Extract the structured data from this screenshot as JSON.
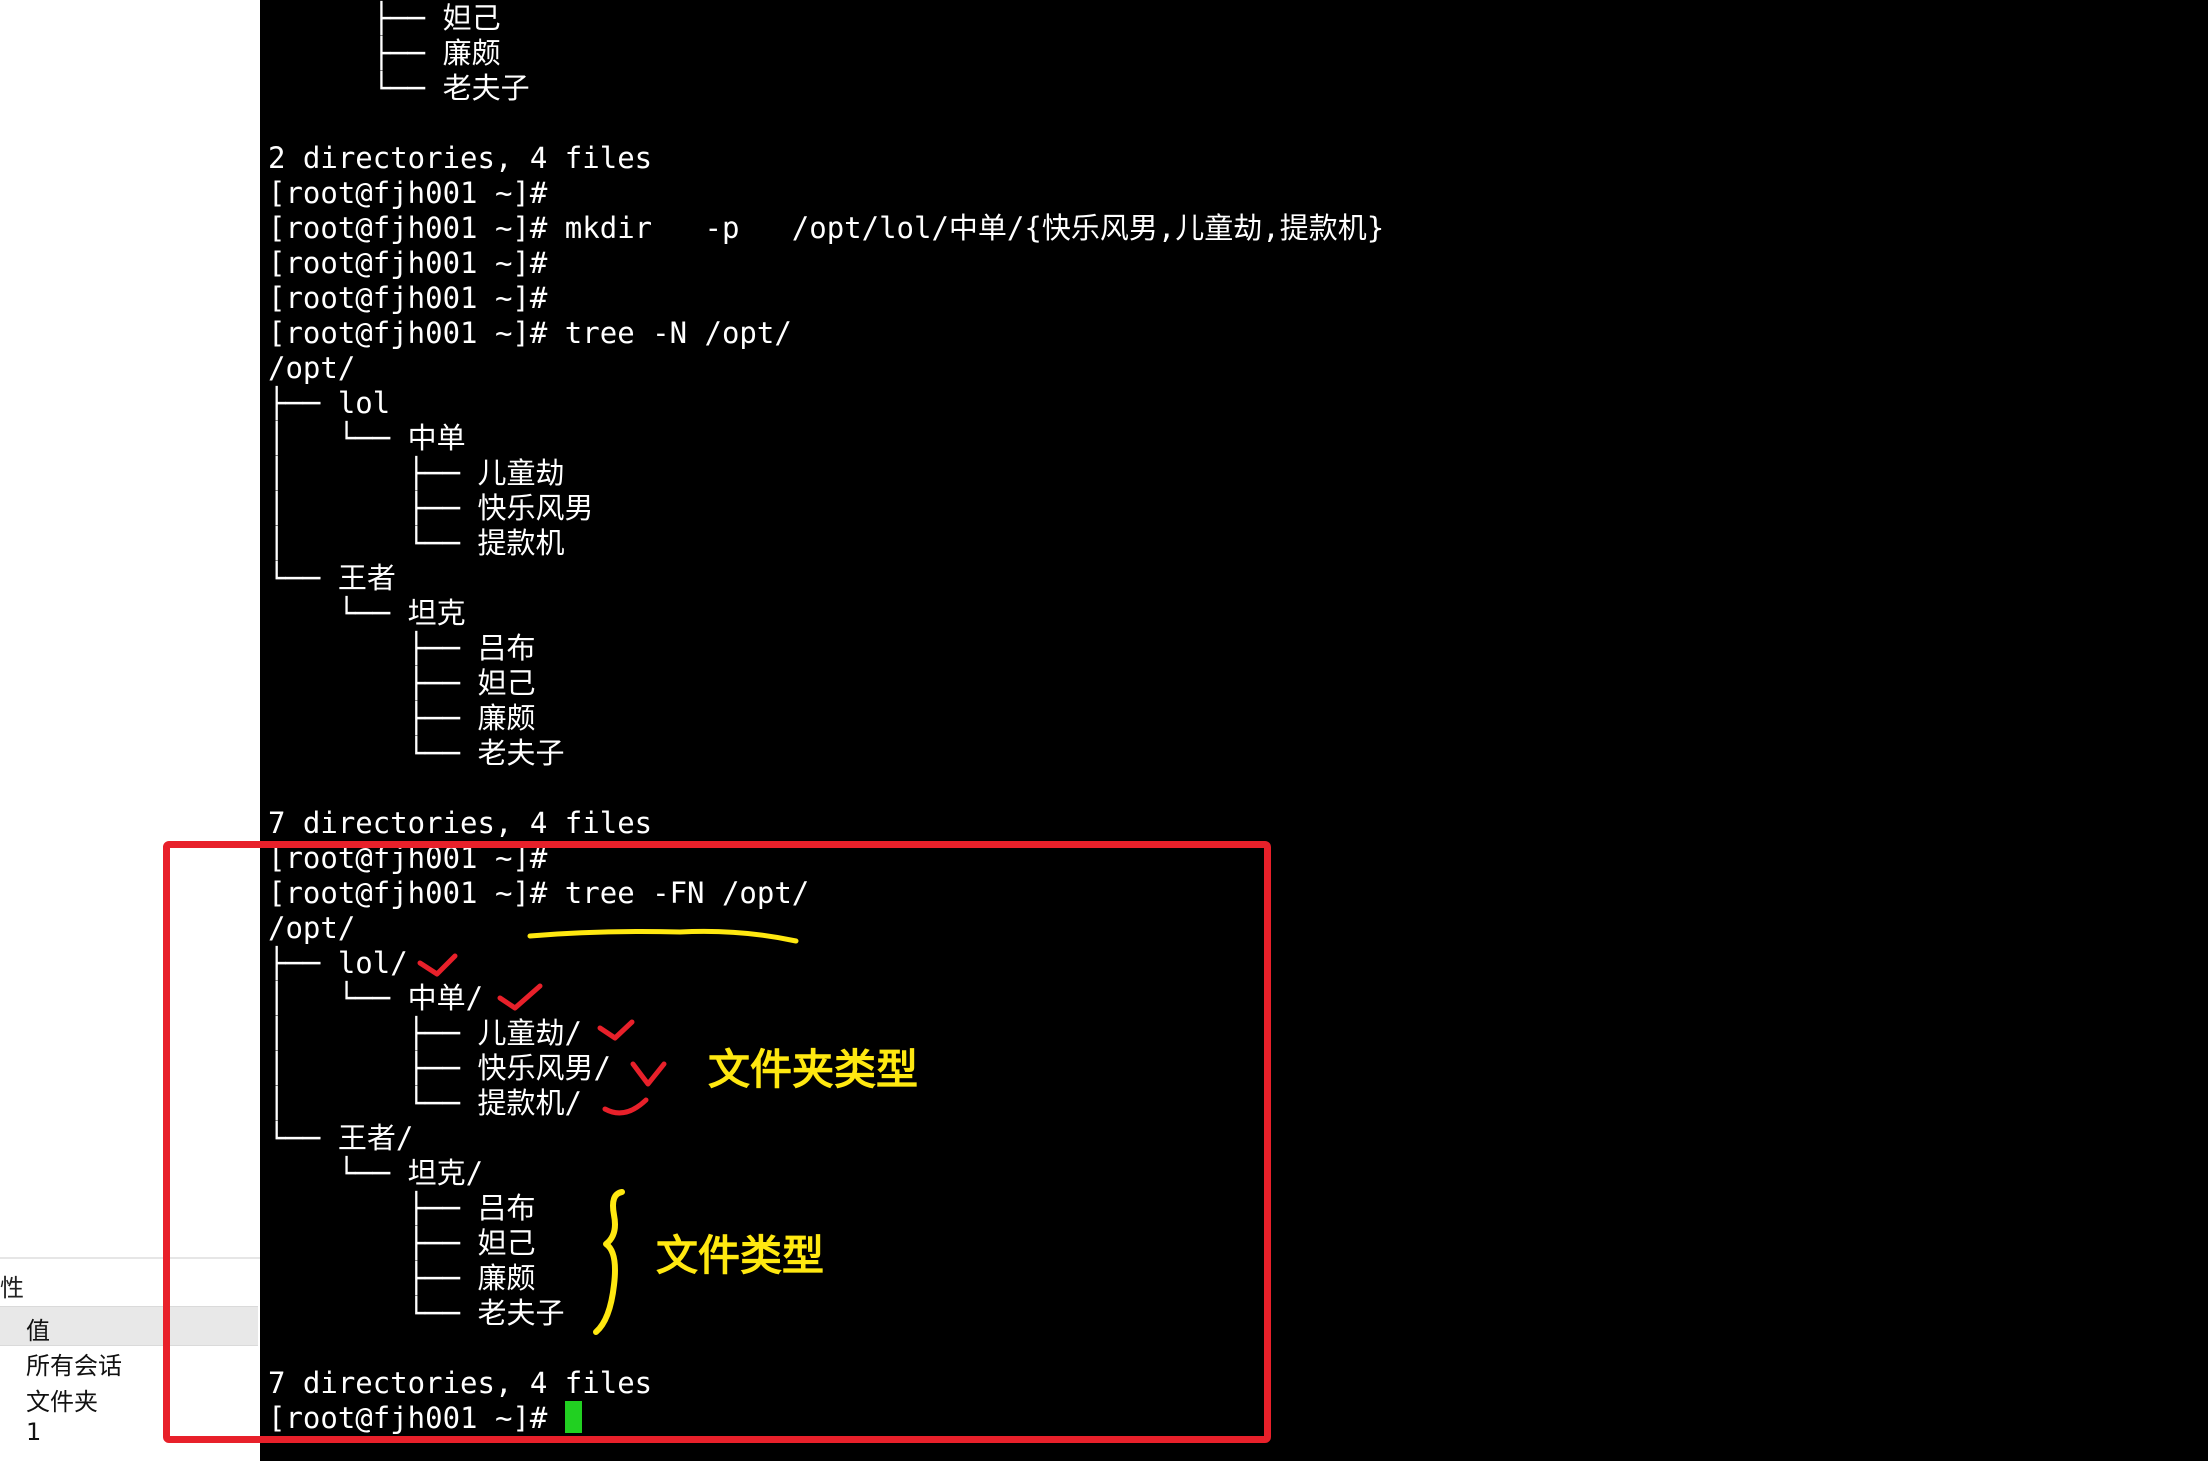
{
  "properties_panel": {
    "title": "性",
    "header": "值",
    "rows": [
      "所有会话",
      "文件夹",
      "1"
    ]
  },
  "terminal": {
    "lines": [
      "      ├── 妲己",
      "      ├── 廉颇",
      "      └── 老夫子",
      "",
      "2 directories, 4 files",
      "[root@fjh001 ~]#",
      "[root@fjh001 ~]# mkdir   -p   /opt/lol/中单/{快乐风男,儿童劫,提款机}",
      "[root@fjh001 ~]#",
      "[root@fjh001 ~]#",
      "[root@fjh001 ~]# tree -N /opt/",
      "/opt/",
      "├── lol",
      "│   └── 中单",
      "│       ├── 儿童劫",
      "│       ├── 快乐风男",
      "│       └── 提款机",
      "└── 王者",
      "    └── 坦克",
      "        ├── 吕布",
      "        ├── 妲己",
      "        ├── 廉颇",
      "        └── 老夫子",
      "",
      "7 directories, 4 files",
      "[root@fjh001 ~]#",
      "[root@fjh001 ~]# tree -FN /opt/",
      "/opt/",
      "├── lol/",
      "│   └── 中单/",
      "│       ├── 儿童劫/",
      "│       ├── 快乐风男/",
      "│       └── 提款机/",
      "└── 王者/",
      "    └── 坦克/",
      "        ├── 吕布",
      "        ├── 妲己",
      "        ├── 廉颇",
      "        └── 老夫子",
      "",
      "7 directories, 4 files",
      "[root@fjh001 ~]# "
    ],
    "cursor_color": "#21d021"
  },
  "annotations": {
    "folder_type_label": "文件夹类型",
    "file_type_label": "文件类型",
    "box_color": "#e8202a",
    "text_color": "#ffe810",
    "check_color": "#e8202a"
  }
}
